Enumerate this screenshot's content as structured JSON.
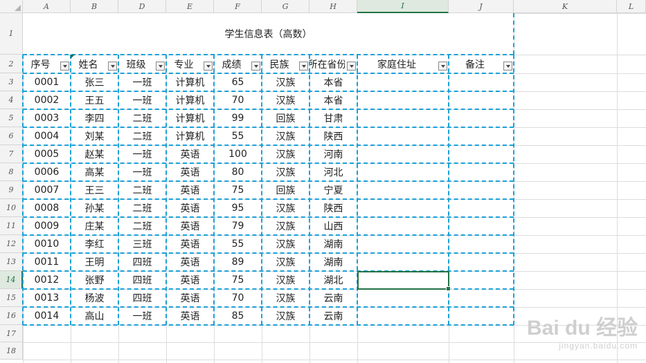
{
  "columns": [
    "A",
    "B",
    "D",
    "E",
    "F",
    "G",
    "H",
    "I",
    "J",
    "K",
    "L"
  ],
  "active_column": "I",
  "active_row": "14",
  "rows": [
    "1",
    "2",
    "3",
    "4",
    "5",
    "6",
    "7",
    "8",
    "9",
    "10",
    "11",
    "12",
    "13",
    "14",
    "15",
    "16",
    "17",
    "18"
  ],
  "sheet_title": "学生信息表（高数）",
  "table": {
    "headers": [
      "序号",
      "姓名",
      "班级",
      "专业",
      "成绩",
      "民族",
      "所在省份",
      "家庭住址",
      "备注"
    ],
    "records": [
      [
        "0001",
        "张三",
        "一班",
        "计算机",
        "65",
        "汉族",
        "本省",
        "",
        ""
      ],
      [
        "0002",
        "王五",
        "一班",
        "计算机",
        "70",
        "汉族",
        "本省",
        "",
        ""
      ],
      [
        "0003",
        "李四",
        "二班",
        "计算机",
        "99",
        "回族",
        "甘肃",
        "",
        ""
      ],
      [
        "0004",
        "刘某",
        "二班",
        "计算机",
        "55",
        "汉族",
        "陕西",
        "",
        ""
      ],
      [
        "0005",
        "赵某",
        "一班",
        "英语",
        "100",
        "汉族",
        "河南",
        "",
        ""
      ],
      [
        "0006",
        "高某",
        "一班",
        "英语",
        "80",
        "汉族",
        "河北",
        "",
        ""
      ],
      [
        "0007",
        "王三",
        "二班",
        "英语",
        "75",
        "回族",
        "宁夏",
        "",
        ""
      ],
      [
        "0008",
        "孙某",
        "二班",
        "英语",
        "95",
        "汉族",
        "陕西",
        "",
        ""
      ],
      [
        "0009",
        "庄某",
        "二班",
        "英语",
        "79",
        "汉族",
        "山西",
        "",
        ""
      ],
      [
        "0010",
        "李红",
        "三班",
        "英语",
        "55",
        "汉族",
        "湖南",
        "",
        ""
      ],
      [
        "0011",
        "王明",
        "四班",
        "英语",
        "89",
        "汉族",
        "湖南",
        "",
        ""
      ],
      [
        "0012",
        "张野",
        "四班",
        "英语",
        "75",
        "汉族",
        "湖北",
        "",
        ""
      ],
      [
        "0013",
        "杨波",
        "四班",
        "英语",
        "70",
        "汉族",
        "云南",
        "",
        ""
      ],
      [
        "0014",
        "高山",
        "一班",
        "英语",
        "85",
        "汉族",
        "云南",
        "",
        ""
      ]
    ]
  },
  "watermark": {
    "main": "Bai du 经验",
    "sub": "jingyan.baidu.com"
  },
  "colors": {
    "accent": "#217346",
    "dashed_border": "#1aa1d8"
  }
}
